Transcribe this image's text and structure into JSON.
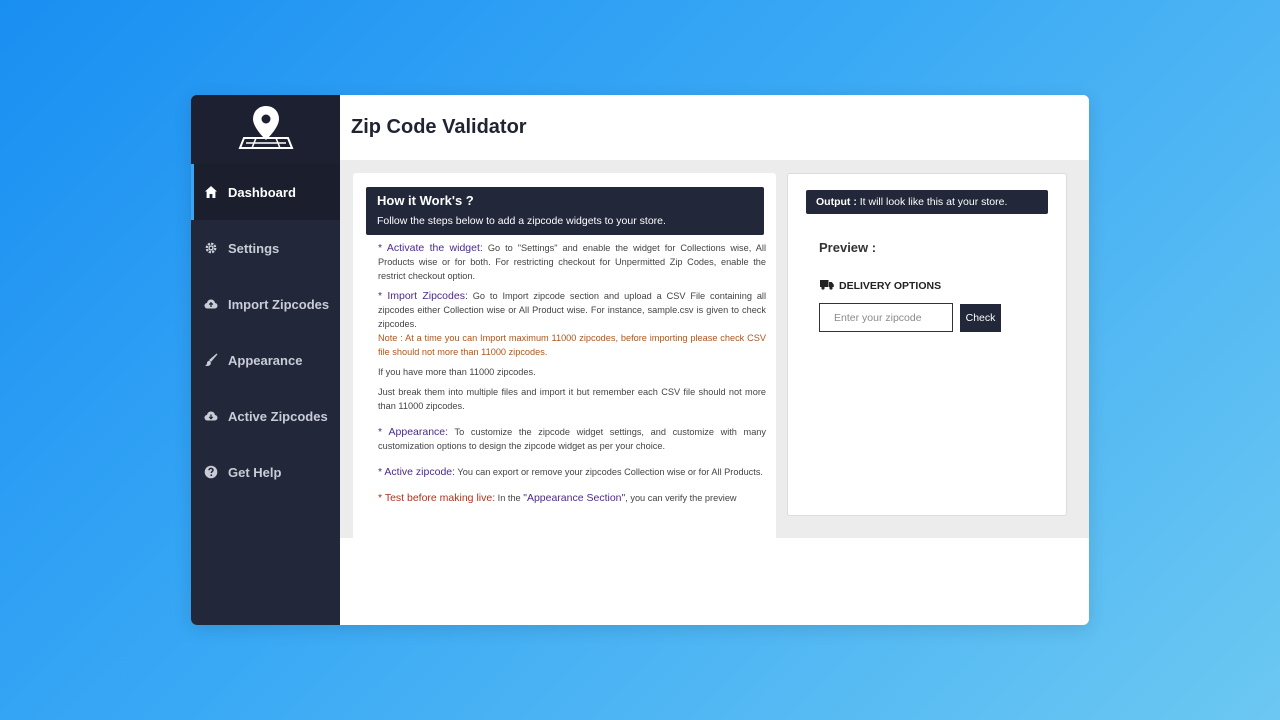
{
  "app": {
    "title": "Zip Code Validator",
    "logo_icon": "map-pin-icon"
  },
  "sidebar": {
    "items": [
      {
        "label": "Dashboard",
        "icon": "home-icon",
        "active": true
      },
      {
        "label": "Settings",
        "icon": "gear-icon",
        "active": false
      },
      {
        "label": "Import Zipcodes",
        "icon": "cloud-upload-icon",
        "active": false
      },
      {
        "label": "Appearance",
        "icon": "brush-icon",
        "active": false
      },
      {
        "label": "Active Zipcodes",
        "icon": "cloud-download-icon",
        "active": false
      },
      {
        "label": "Get Help",
        "icon": "question-icon",
        "active": false
      }
    ]
  },
  "how": {
    "title": "How it Work's ?",
    "subtitle": "Follow the steps below to add a zipcode widgets to your store.",
    "activate_head": "* Activate the widget:",
    "activate_text": " Go to \"Settings\" and enable the widget for Collections wise, All Products wise or for both. For restricting checkout for Unpermitted Zip Codes, enable the restrict checkout option.",
    "import_head": "* Import Zipcodes:",
    "import_text": " Go to Import zipcode section and upload a CSV File containing all zipcodes either Collection wise or All Product wise. For instance, sample.csv is given to check zipcodes.",
    "note": "Note : At a time you can Import maximum 11000 zipcodes, before importing please check CSV file should not more than 11000 zipcodes.",
    "more": "If you have more than 11000 zipcodes.",
    "break": "Just break them into multiple files and import it but remember each CSV file should not more than 11000 zipcodes.",
    "appearance_head": "* Appearance:",
    "appearance_text": " To customize the zipcode widget settings, and customize with many customization options to design the zipcode widget as per your choice.",
    "active_head": "* Active zipcode:",
    "active_text": " You can export or remove your zipcodes Collection wise or for All Products.",
    "test_head": "* Test before making live:",
    "test_mid": " In the ",
    "test_section": "\"Appearance Section\"",
    "test_text": ", you can verify the preview"
  },
  "output": {
    "label": "Output :",
    "text": " It will look like this at your store.",
    "preview_title": "Preview :",
    "delivery_icon": "truck-icon",
    "delivery_label": "DELIVERY OPTIONS",
    "zip_placeholder": "Enter your zipcode",
    "zip_value": "",
    "check_label": "Check"
  }
}
